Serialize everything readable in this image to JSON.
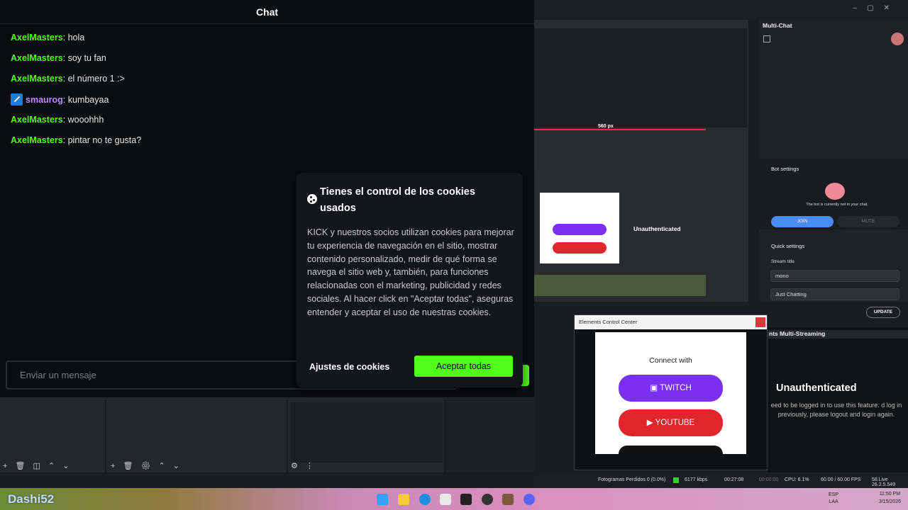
{
  "chat": {
    "title": "Chat",
    "messages": [
      {
        "user": "AxelMasters",
        "text": ": hola"
      },
      {
        "user": "AxelMasters",
        "text": ": soy tu fan"
      },
      {
        "user": "AxelMasters",
        "text": ": el número 1 :>"
      },
      {
        "user": "smaurog",
        "text": ": kumbayaa"
      },
      {
        "user": "AxelMasters",
        "text": ": wooohhh"
      },
      {
        "user": "AxelMasters",
        "text": ": pintar no te gusta?"
      }
    ],
    "input_placeholder": "Enviar un mensaje"
  },
  "cookie_dialog": {
    "title": "Tienes el control de los cookies usados",
    "body": "KICK y nuestros socios utilizan cookies para mejorar tu experiencia de navegación en el sitio, mostrar contenido personalizado, medir de qué forma se navega el sitio web y, también, para funciones relacionadas con el marketing, publicidad y redes sociales. Al hacer click en \"Aceptar todas\", aseguras entender y aceptar el uso de nuestras cookies.",
    "settings_label": "Ajustes de cookies",
    "accept_label": "Aceptar todas"
  },
  "multichat": {
    "title": "Multi-Chat",
    "bot_settings": "Bot settings",
    "bot_status": "The bot is currently not in your chat.",
    "join": "JOIN",
    "mute": "MUTE",
    "quick_settings": "Quick settings",
    "stream_title_label": "Stream title",
    "stream_title_value": "mono",
    "category_value": "Just Chatting",
    "update": "UPDATE"
  },
  "preview": {
    "px_label": "560 px",
    "unauth_small": "Unauthenticated"
  },
  "ecc": {
    "title": "Elements Control Center",
    "connect_with": "Connect with",
    "twitch": "TWITCH",
    "youtube": "YOUTUBE"
  },
  "multistream": {
    "title": "nts Multi-Streaming",
    "heading": "Unauthenticated",
    "body": "eed to be logged in to use this feature. d log in previously, please logout and login again."
  },
  "statusbar": {
    "dropped": "Fotogramas Perdidos 0 (0.0%)",
    "kbps": "6177 kbps",
    "time1": "00:27:08",
    "time2": "00:00:00",
    "cpu": "CPU: 6.1%",
    "fps": "60.00 / 60.00 FPS",
    "version": "58.Live 26.2.5.549"
  },
  "taskbar": {
    "watermark": "Dashi52",
    "lang1": "ESP",
    "lang2": "LAA",
    "time": "11:50 PM",
    "date": "3/15/2026"
  },
  "colors": {
    "kick_green": "#53fc18",
    "twitch": "#7b2ff2",
    "youtube": "#e0262b",
    "join_blue": "#4c8bf5"
  }
}
